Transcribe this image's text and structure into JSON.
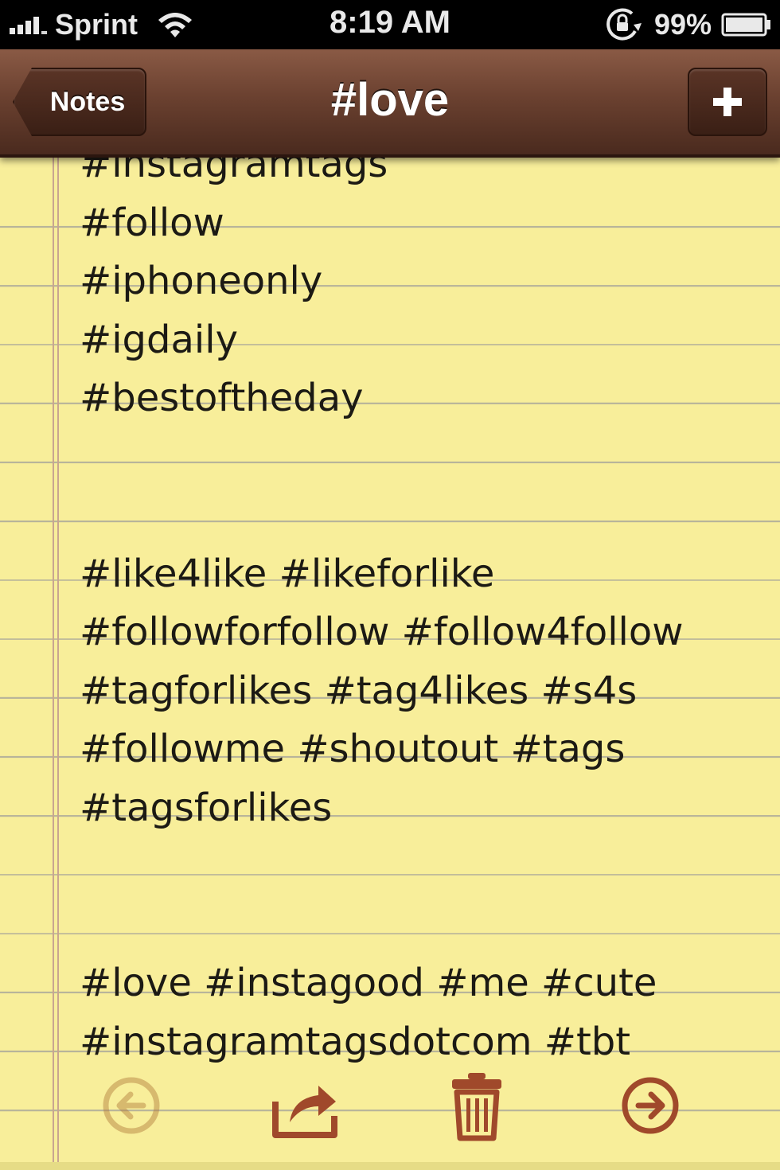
{
  "status_bar": {
    "carrier": "Sprint",
    "time": "8:19 AM",
    "battery_percent": "99%",
    "signal_icon": "cellular-signal-icon",
    "wifi_icon": "wifi-icon",
    "rotation_lock_icon": "rotation-lock-icon",
    "battery_icon": "battery-icon"
  },
  "nav": {
    "back_label": "Notes",
    "title": "#love",
    "add_icon": "plus-icon"
  },
  "note": {
    "lines": [
      "#instagramtags",
      "#follow",
      "#iphoneonly",
      "#igdaily",
      "#bestoftheday",
      "",
      "",
      "#like4like #likeforlike",
      "#followforfollow #follow4follow",
      "#tagforlikes #tag4likes #s4s",
      "#followme #shoutout #tags",
      "#tagsforlikes",
      "",
      "",
      "#love #instagood #me #cute",
      "#instagramtagsdotcom #tbt"
    ]
  },
  "toolbar": {
    "previous_icon": "arrow-left-circle-icon",
    "share_icon": "share-icon",
    "trash_icon": "trash-icon",
    "next_icon": "arrow-right-circle-icon"
  },
  "colors": {
    "paper": "#f8ee9a",
    "rule_line": "#b8b49a",
    "margin_line": "#c9a590",
    "leather": "#6b4130",
    "toolbar_icon": "#a0492b"
  }
}
